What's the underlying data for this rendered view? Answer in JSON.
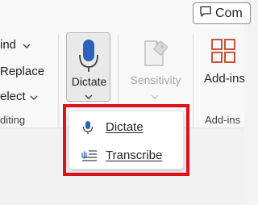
{
  "header": {
    "comments_label": "Com"
  },
  "editing": {
    "find_label": "ind",
    "replace_label": "Replace",
    "select_label": "elect",
    "group_label": "diting"
  },
  "voice": {
    "dictate_label": "Dictate"
  },
  "sensitivity": {
    "label": "Sensitivity"
  },
  "addins": {
    "label": "Add-ins",
    "group_label": "Add-ins"
  },
  "dictate_menu": {
    "items": [
      {
        "label": "Dictate",
        "icon": "microphone-icon"
      },
      {
        "label": "Transcribe",
        "icon": "transcribe-icon"
      }
    ]
  },
  "colors": {
    "accent": "#2b63b8",
    "highlight": "#e0111b",
    "addins_icon": "#c8553d"
  }
}
